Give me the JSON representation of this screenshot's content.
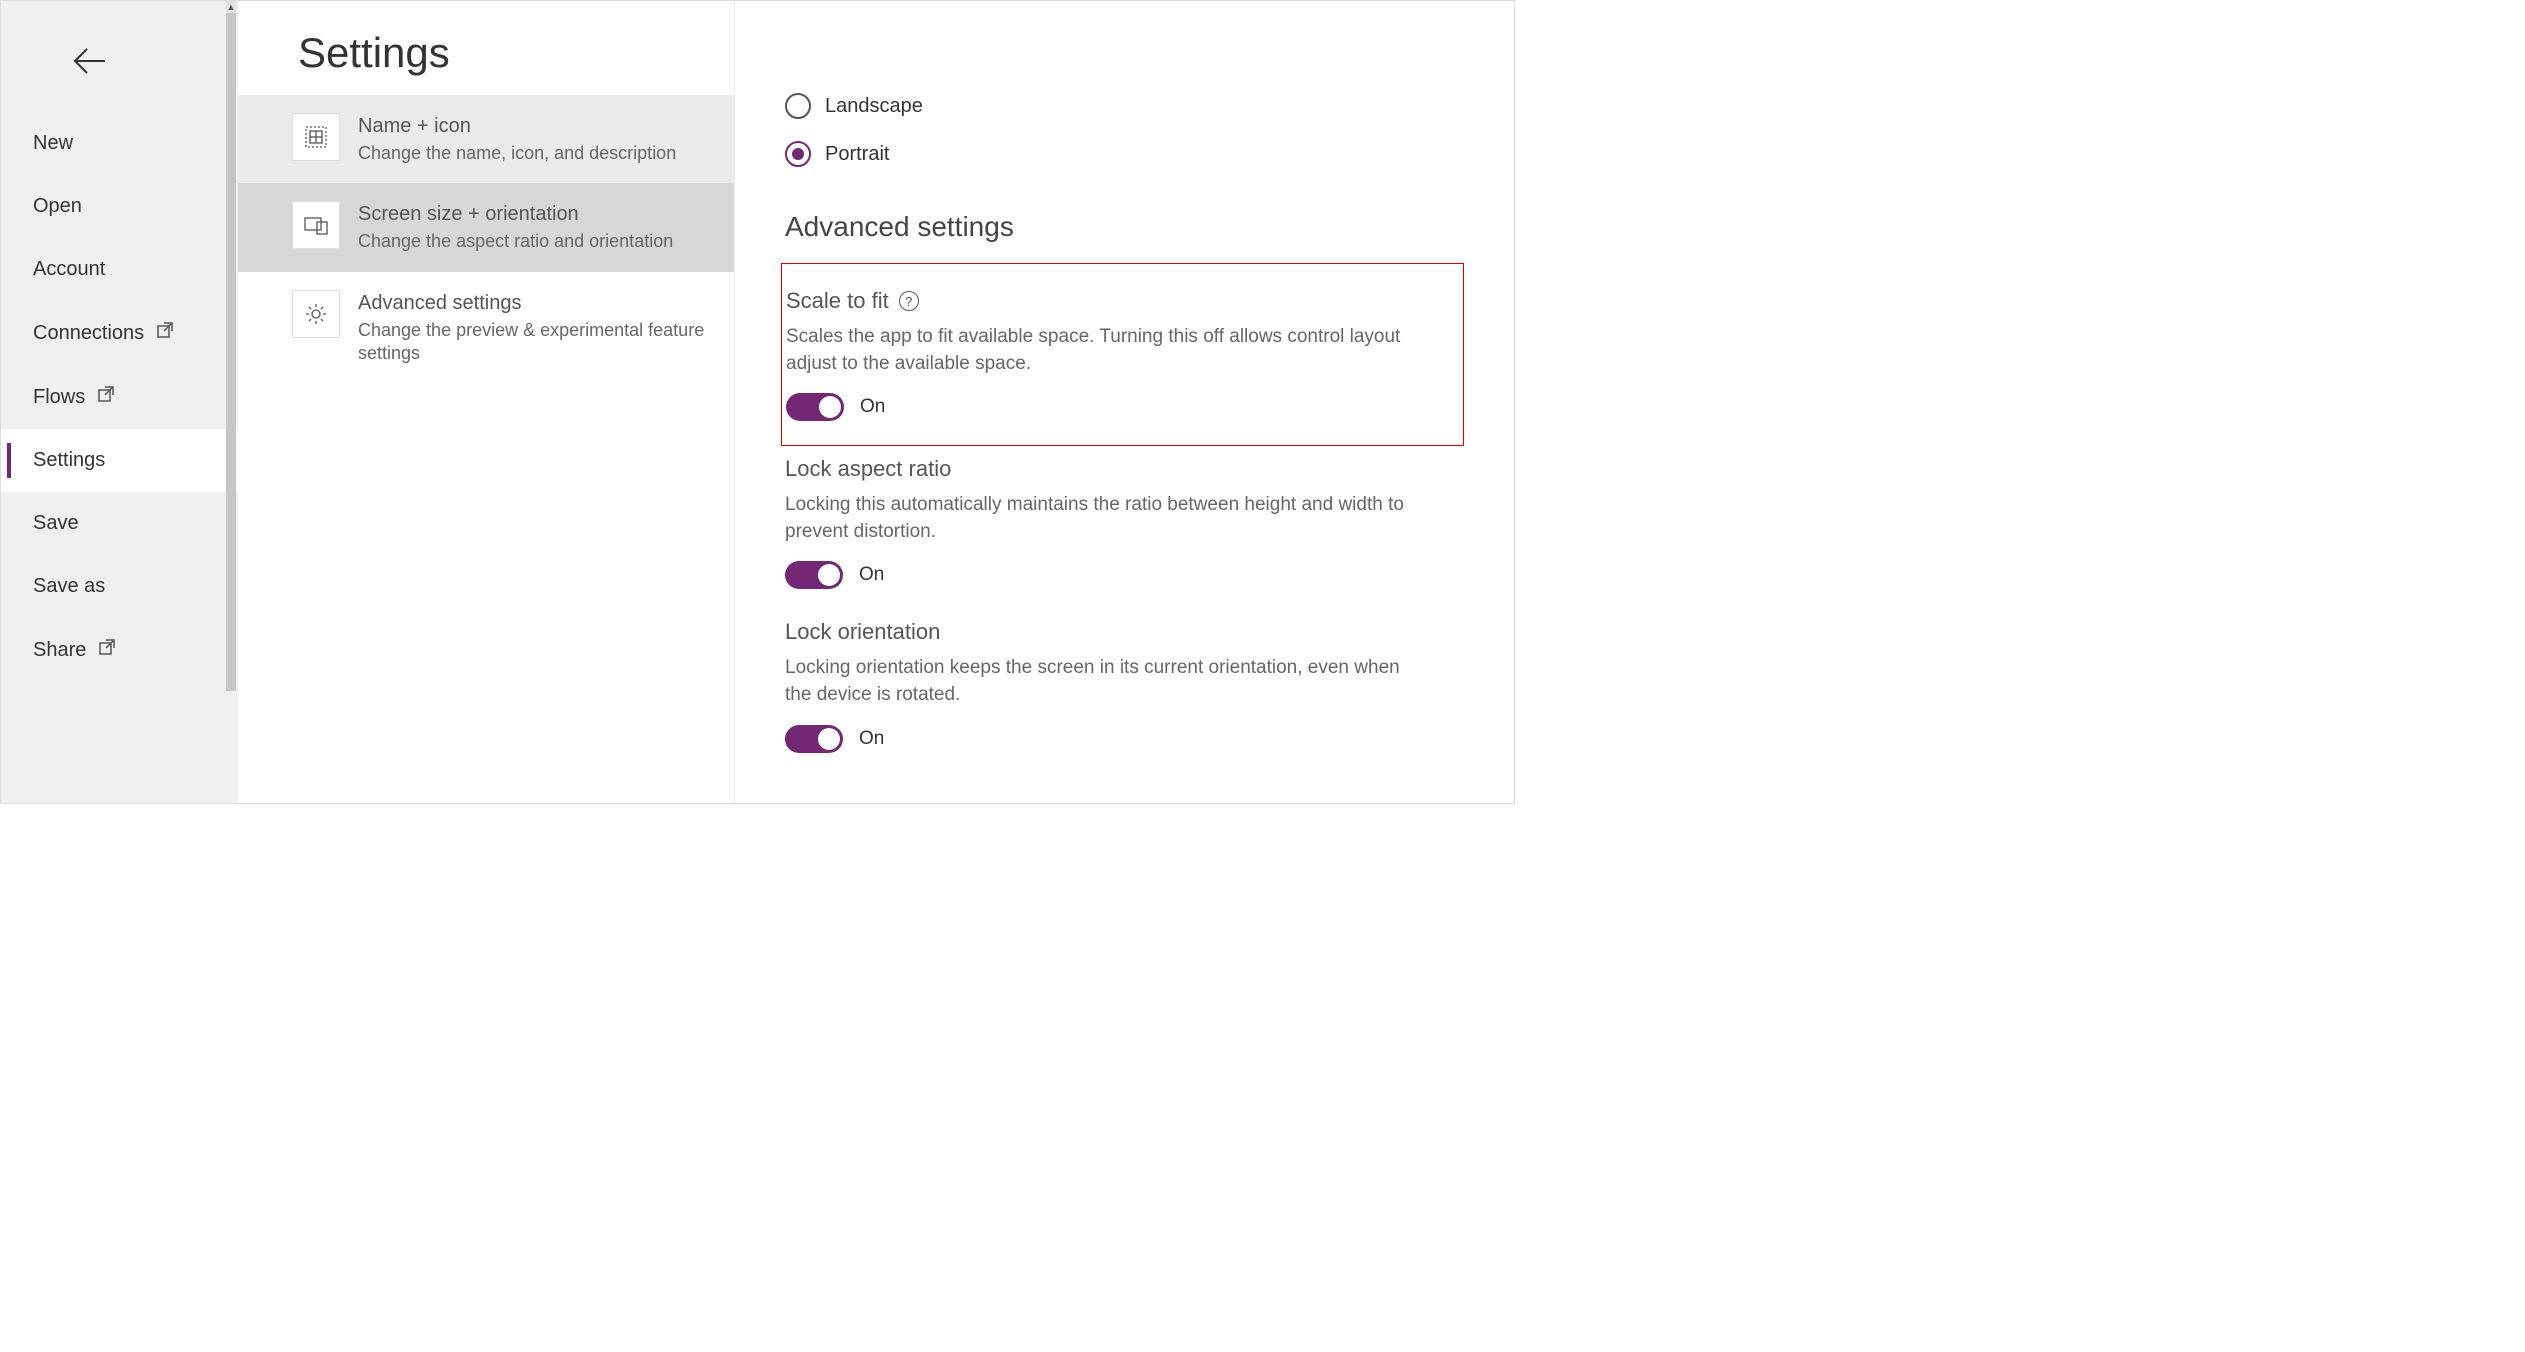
{
  "sidebar": {
    "items": [
      {
        "label": "New",
        "external": false
      },
      {
        "label": "Open",
        "external": false
      },
      {
        "label": "Account",
        "external": false
      },
      {
        "label": "Connections",
        "external": true
      },
      {
        "label": "Flows",
        "external": true
      },
      {
        "label": "Settings",
        "external": false,
        "active": true
      },
      {
        "label": "Save",
        "external": false
      },
      {
        "label": "Save as",
        "external": false
      },
      {
        "label": "Share",
        "external": true
      }
    ]
  },
  "page_title": "Settings",
  "categories": [
    {
      "title": "Name + icon",
      "desc": "Change the name, icon, and description",
      "state": "hover"
    },
    {
      "title": "Screen size + orientation",
      "desc": "Change the aspect ratio and orientation",
      "state": "selected"
    },
    {
      "title": "Advanced settings",
      "desc": "Change the preview & experimental feature settings",
      "state": ""
    }
  ],
  "orientation": {
    "options": [
      {
        "label": "Landscape",
        "checked": false
      },
      {
        "label": "Portrait",
        "checked": true
      }
    ]
  },
  "advanced_section_title": "Advanced settings",
  "settings": {
    "scale_to_fit": {
      "title": "Scale to fit",
      "desc": "Scales the app to fit available space. Turning this off allows control layout adjust to the available space.",
      "state_label": "On"
    },
    "lock_aspect": {
      "title": "Lock aspect ratio",
      "desc": "Locking this automatically maintains the ratio between height and width to prevent distortion.",
      "state_label": "On"
    },
    "lock_orientation": {
      "title": "Lock orientation",
      "desc": "Locking orientation keeps the screen in its current orientation, even when the device is rotated.",
      "state_label": "On"
    }
  }
}
